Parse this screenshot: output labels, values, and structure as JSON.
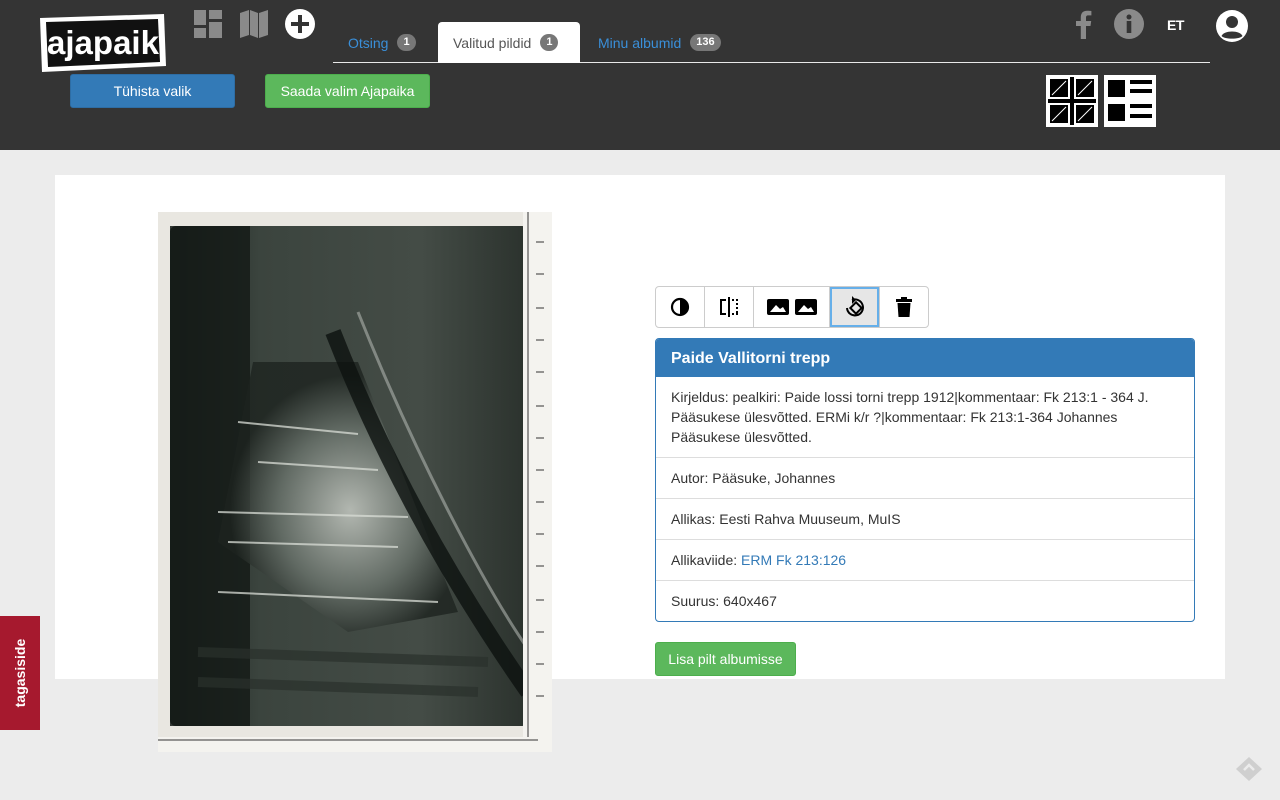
{
  "header": {
    "logo_text": "ajapaik",
    "tabs": [
      {
        "label": "Otsing",
        "count": "1"
      },
      {
        "label": "Valitud pildid",
        "count": "1"
      },
      {
        "label": "Minu albumid",
        "count": "136"
      }
    ],
    "language": "ET",
    "clear_selection_label": "Tühista valik",
    "send_selection_label": "Saada valim Ajapaika",
    "icons": [
      "dashboard-icon",
      "map-icon",
      "add-circle-icon",
      "facebook-icon",
      "info-icon",
      "user-account-icon",
      "grid-view-icon",
      "list-view-icon"
    ]
  },
  "tools": {
    "icons": [
      "contrast-icon",
      "flip-icon",
      "compare-images-icon",
      "rotate-icon",
      "delete-icon"
    ],
    "active": "rotate-icon"
  },
  "photo_info": {
    "title": "Paide Vallitorni trepp",
    "description": "Kirjeldus: pealkiri: Paide lossi torni trepp 1912|kommentaar: Fk 213:1 - 364 J. Pääsukese ülesvõtted. ERMi k/r ?|kommentaar: Fk 213:1-364 Johannes Pääsukese ülesvõtted.",
    "author": "Autor: Pääsuke, Johannes",
    "source": "Allikas: Eesti Rahva Muuseum, MuIS",
    "source_ref_label": "Allikaviide:",
    "source_ref_link": "ERM Fk 213:126",
    "size": "Suurus: 640x467"
  },
  "add_to_album_label": "Lisa pilt albumisse",
  "feedback_label": "tagasiside",
  "colors": {
    "header_bg": "#343434",
    "primary": "#337ab7",
    "success": "#5cb85c",
    "feedback": "#a6192e",
    "link": "#3a8fd9"
  }
}
